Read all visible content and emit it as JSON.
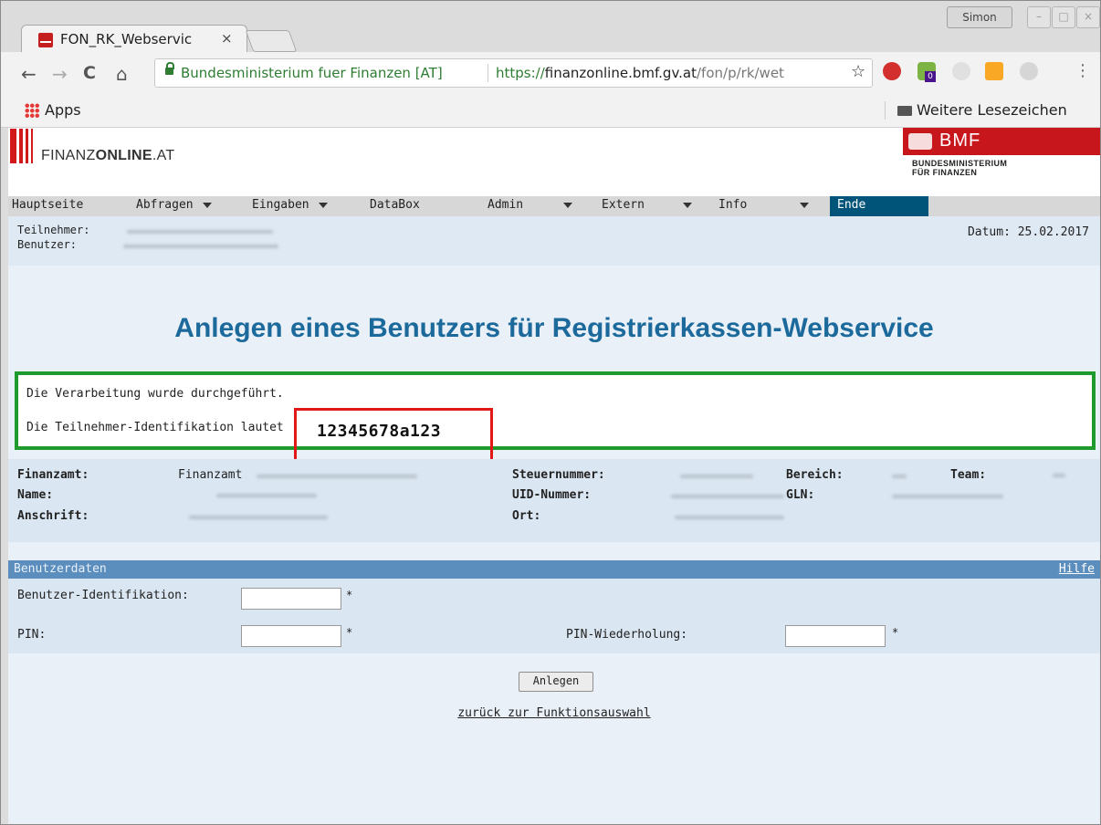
{
  "browser": {
    "tab_title": "FON_RK_Webservic",
    "tab_close": "×",
    "window_user": "Simon",
    "window_controls": [
      "–",
      "□",
      "×"
    ],
    "nav": {
      "back": "←",
      "forward": "→",
      "reload": "C",
      "home": "⌂"
    },
    "address": {
      "secure_label": "Bundesministerium fuer Finanzen [AT]",
      "url_scheme": "https://",
      "url_host": "finanzonline.bmf.gv.at",
      "url_path": "/fon/p/rk/wet"
    },
    "star": "☆",
    "menu": "⋮",
    "extensions": [
      "adblock-icon",
      "ghostery-icon",
      "extension-icon",
      "chart-extension-icon",
      "extension-icon-2"
    ],
    "ext_badge": "0",
    "bookmarks": {
      "apps_label": "Apps",
      "other_label": "Weitere Lesezeichen"
    }
  },
  "header": {
    "brand_prefix": "FINANZ",
    "brand_bold": "ONLINE",
    "brand_suffix": ".AT",
    "bmf_label": "BMF",
    "bmf_sub1": "BUNDESMINISTERIUM",
    "bmf_sub2": "FÜR FINANZEN"
  },
  "menu": {
    "items": [
      "Hauptseite",
      "Abfragen",
      "Eingaben",
      "DataBox",
      "Admin",
      "Extern",
      "Info"
    ],
    "ende": "Ende"
  },
  "userbar": {
    "teilnehmer_label": "Teilnehmer:",
    "benutzer_label": "Benutzer:",
    "date": "Datum: 25.02.2017"
  },
  "page_title": "Anlegen eines Benutzers für Registrierkassen-Webservice",
  "result": {
    "msg_processed": "Die Verarbeitung wurde durchgeführt.",
    "msg_id_label": "Die Teilnehmer-Identifikation lautet",
    "id_value": "12345678a123"
  },
  "info": {
    "finanzamt_label": "Finanzamt:",
    "finanzamt_value": "Finanzamt",
    "name_label": "Name:",
    "anschrift_label": "Anschrift:",
    "steuernummer_label": "Steuernummer:",
    "uid_label": "UID-Nummer:",
    "ort_label": "Ort:",
    "bereich_label": "Bereich:",
    "team_label": "Team:",
    "gln_label": "GLN:"
  },
  "benutzerdaten": {
    "title": "Benutzerdaten",
    "help": "Hilfe",
    "benutzer_id_label": "Benutzer-Identifikation:",
    "pin_label": "PIN:",
    "pin_repeat_label": "PIN-Wiederholung:",
    "required_marker": "*",
    "benutzer_id_value": "",
    "pin_value": "",
    "pin_repeat_value": ""
  },
  "actions": {
    "submit_label": "Anlegen",
    "back_link": "zurück zur Funktionsauswahl"
  }
}
